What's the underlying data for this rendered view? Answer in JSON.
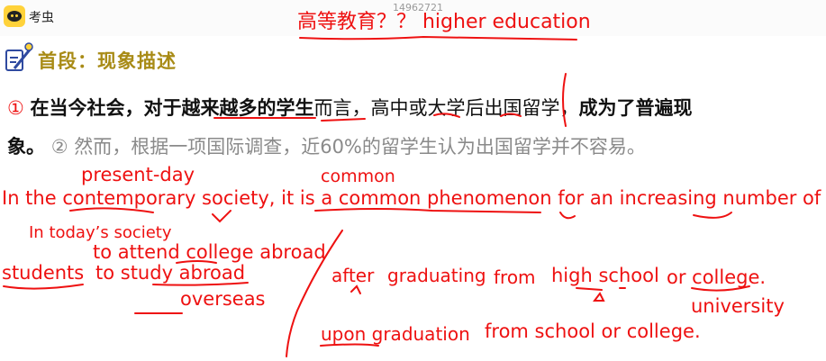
{
  "app": {
    "brand": "考虫",
    "session_id": "14962721"
  },
  "annotation_title": "高等教育？？ higher education",
  "section": {
    "heading": "首段：现象描述"
  },
  "sentence1": {
    "number": "①",
    "part_a": "在当今社会，对于越来越多的学生",
    "part_b": "而言，高中或大学后出国留学，",
    "part_c": "成为了普遍现",
    "part_d": "象。"
  },
  "sentence2": {
    "number": "②",
    "text": "然而，根据一项国际调查，近60%的留学生认为出国留学并不容易。"
  },
  "handwriting": {
    "present_day": "present-day",
    "common": "common",
    "main_line": "In the contemporary society,  it is a common phenomenon for an increasing number of",
    "in_today": "In today’s society",
    "attend": "to attend college abroad",
    "students": "students",
    "study_abroad": "to study abroad",
    "after": "after",
    "graduating": "graduating",
    "from": "from",
    "high_school": "high school",
    "or_college": "or college.",
    "overseas": "overseas",
    "university": "university",
    "upon_graduation": "upon graduation",
    "from_school": "from school or college."
  },
  "colors": {
    "ink": "#ee1111",
    "heading": "#a88b16",
    "logo": "#ffd23a"
  }
}
